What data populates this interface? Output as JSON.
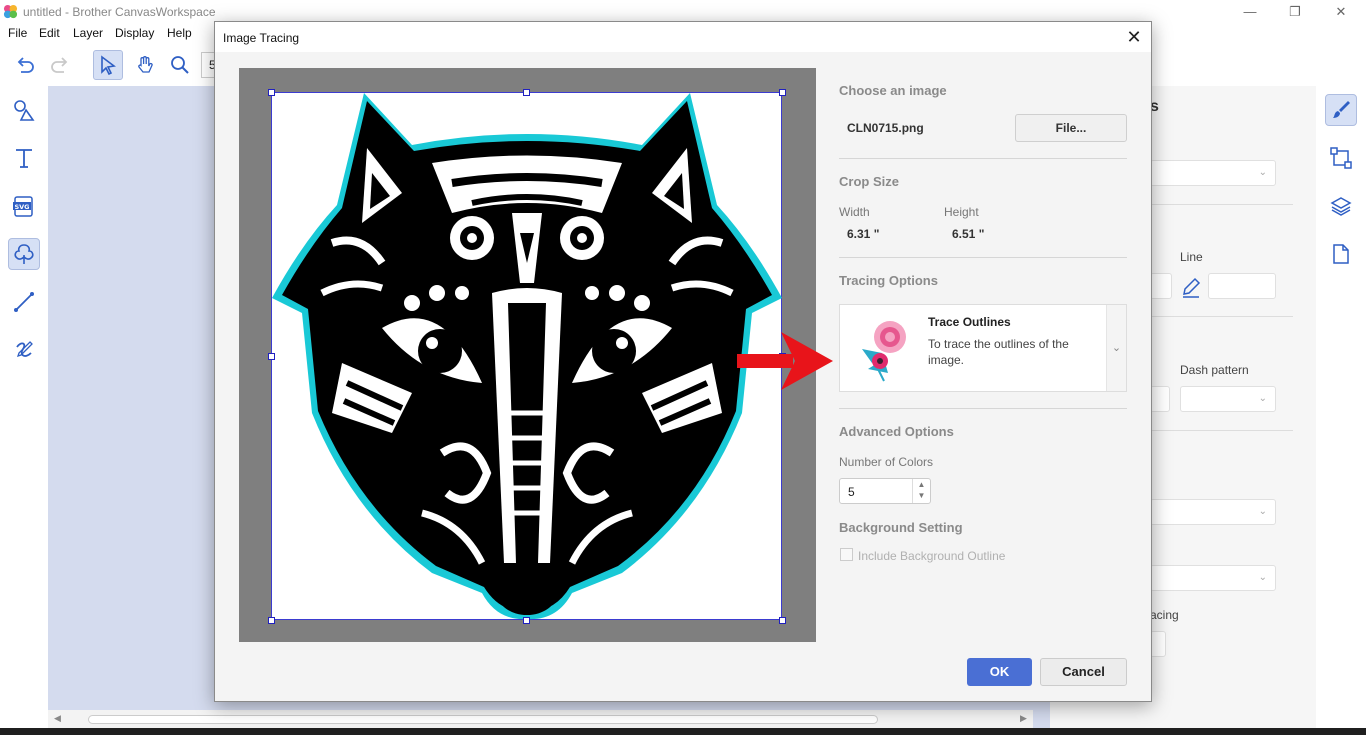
{
  "window": {
    "title": "untitled - Brother CanvasWorkspace",
    "min_glyph": "—",
    "restore_glyph": "❐",
    "close_glyph": "✕"
  },
  "menu": [
    "File",
    "Edit",
    "Layer",
    "Display",
    "Help"
  ],
  "toolbar": {
    "zoom_value": "5"
  },
  "properties": {
    "line_label": "Line",
    "dash_label": "Dash pattern",
    "spacing_label": "acing",
    "heading_fragment": "s"
  },
  "dialog": {
    "title": "Image Tracing",
    "close_glyph": "✕",
    "choose_image": {
      "heading": "Choose an image",
      "filename": "CLN0715.png",
      "file_button": "File..."
    },
    "crop_size": {
      "heading": "Crop Size",
      "width_label": "Width",
      "width_value": "6.31 \"",
      "height_label": "Height",
      "height_value": "6.51 \""
    },
    "tracing_options": {
      "heading": "Tracing Options",
      "option_title": "Trace Outlines",
      "option_desc": "To trace the outlines of the image."
    },
    "advanced": {
      "heading": "Advanced Options",
      "colors_label": "Number of Colors",
      "colors_value": "5",
      "bg_heading": "Background Setting",
      "bg_checkbox_label": "Include Background Outline",
      "bg_checked": false
    },
    "ok": "OK",
    "cancel": "Cancel"
  },
  "colors": {
    "accent": "#4a6fd4",
    "canvas_bg": "#d4dbee",
    "arrow": "#e8141a",
    "outline": "#19c9d6"
  }
}
